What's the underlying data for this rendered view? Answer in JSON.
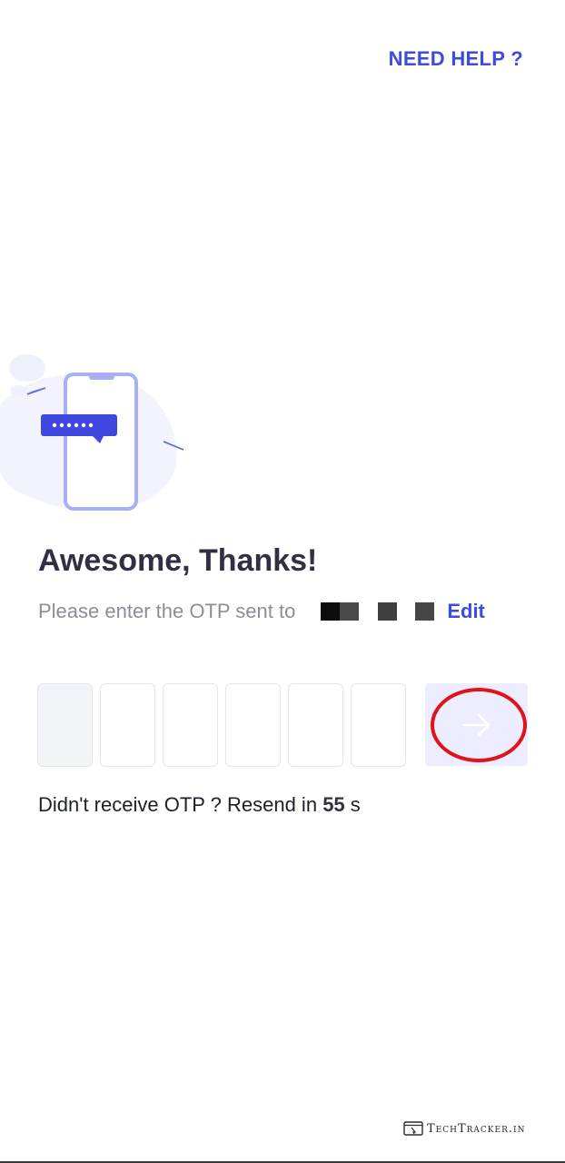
{
  "header": {
    "help_label": "NEED HELP ?"
  },
  "main": {
    "title": "Awesome, Thanks!",
    "subtitle": "Please enter the OTP sent to",
    "edit_label": "Edit",
    "otp_digit_count": 6,
    "resend_prefix": "Didn't receive OTP ? Resend in",
    "resend_seconds": "55",
    "resend_unit": "s"
  },
  "watermark": {
    "text": "TechTracker.in"
  },
  "icons": {
    "illustration": "phone-otp-illustration",
    "submit": "arrow-right-icon"
  },
  "colors": {
    "accent": "#3d4be0",
    "submit_bg": "#eceeff",
    "highlight_ring": "#e0121a",
    "title": "#2e3142",
    "muted": "#8c8e97"
  }
}
